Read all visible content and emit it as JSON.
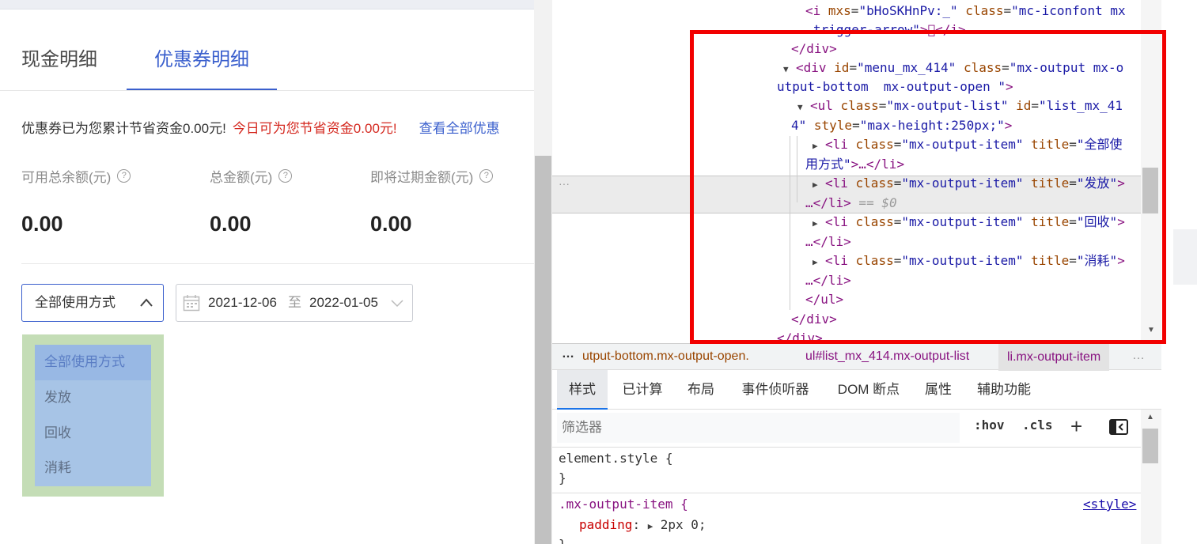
{
  "tabs": {
    "cash": "现金明细",
    "coupon": "优惠券明细"
  },
  "savings": {
    "total": "优惠券已为您累计节省资金0.00元!",
    "today": "今日可为您节省资金0.00元!",
    "view_all": "查看全部优惠"
  },
  "stats": [
    {
      "label": "可用总余额(元)",
      "value": "0.00"
    },
    {
      "label": "总金额(元)",
      "value": "0.00"
    },
    {
      "label": "即将过期金额(元)",
      "value": "0.00"
    }
  ],
  "usage_select": {
    "value": "全部使用方式"
  },
  "date_range": {
    "start": "2021-12-06",
    "separator": "至",
    "end": "2022-01-05"
  },
  "dropdown": {
    "items": [
      "全部使用方式",
      "发放",
      "回收",
      "消耗"
    ]
  },
  "help_glyph": "?",
  "devtools": {
    "code": {
      "l1_tag": "<i",
      "l1_attr1": " mxs",
      "l1_val1": "\"bHoSKHnPv:_\"",
      "l1_attr2": " class",
      "l1_val2": "\"mc-iconfont mx",
      "l2_val": "trigger-arrow\"",
      "l2_tag": ">\u0000</i>",
      "l3": "</div>",
      "l4_tag": "<div",
      "l4_attr1": " id",
      "l4_val1": "\"menu_mx_414\"",
      "l4_attr2": " class",
      "l4_val2": "\"mx-output mx-o",
      "l5_val": "utput-bottom  mx-output-open \"",
      "l5_tag": ">",
      "l6_tag": "<ul",
      "l6_attr1": " class",
      "l6_val1": "\"mx-output-list\"",
      "l6_attr2": " id",
      "l6_val2": "\"list_mx_41",
      "l7_val": "4\"",
      "l7_attr": " style",
      "l7_val2": "\"max-height:250px;\"",
      "l7_tag": ">",
      "li_tag": "<li",
      "li_attr1": " class",
      "li_val1": "\"mx-output-item\"",
      "li_attr2": " title",
      "li1_title": "\"全部使",
      "li1_cont": "用方式\"",
      "li1_end": ">…</li>",
      "li2_title": "\"发放\"",
      "li3_title": "\"回收\"",
      "li4_title": "\"消耗\"",
      "li_open_end": ">",
      "li_close": "…</li>",
      "eq0": " == $0",
      "l_ul_close": "</ul>",
      "l_div_close": "</div>",
      "l_div_close2": "</div>"
    },
    "row_dots": "···",
    "breadcrumb": {
      "more": "…",
      "items": [
        "utput-bottom.mx-output-open.",
        "ul#list_mx_414.mx-output-list",
        "li.mx-output-item"
      ]
    },
    "style_tabs": [
      "样式",
      "已计算",
      "布局",
      "事件侦听器",
      "DOM 断点",
      "属性",
      "辅助功能"
    ],
    "filter_placeholder": "筛选器",
    "hov": ":hov",
    "cls": ".cls",
    "plus": "+",
    "rules": {
      "element_style": "element.style {",
      "close": "}",
      "selector": ".mx-output-item {",
      "prop": "padding",
      "value": "2px 0;",
      "source": "<style>"
    }
  },
  "colors": {
    "accent": "#3a5fcd",
    "red_text": "#d4271e",
    "highlight": "#f20000",
    "dropdown_bg": "#a7c4e6",
    "dropdown_outer": "#c4ddb6"
  },
  "icons": [
    "help-circle-icon",
    "chevron-up-icon",
    "calendar-icon",
    "chevron-down-icon",
    "expand-triangle-icon",
    "add-rule-icon",
    "toggle-sidebar-icon"
  ]
}
